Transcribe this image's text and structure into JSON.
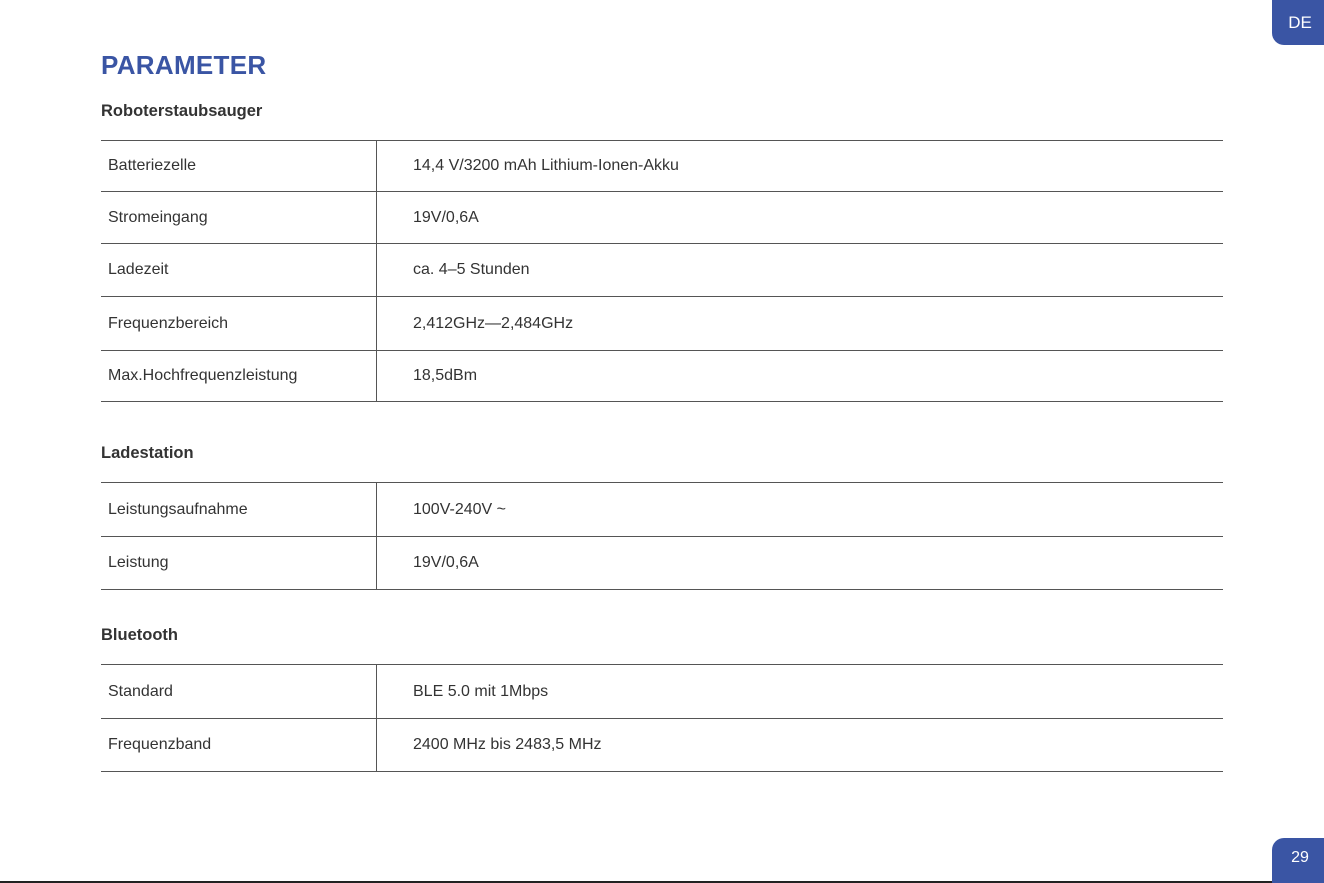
{
  "lang_tab": "DE",
  "page_number": "29",
  "title": "PARAMETER",
  "sections": [
    {
      "heading": "Roboterstaubsauger",
      "rows": [
        {
          "label": "Batteriezelle",
          "value": "14,4 V/3200 mAh Lithium-Ionen-Akku"
        },
        {
          "label": "Stromeingang",
          "value": "19V/0,6A"
        },
        {
          "label": "Ladezeit",
          "value": "ca. 4–5 Stunden"
        },
        {
          "label": "Frequenzbereich",
          "value": "2,412GHz—2,484GHz"
        },
        {
          "label": "Max.Hochfrequenzleistung",
          "value": "18,5dBm"
        }
      ]
    },
    {
      "heading": "Ladestation",
      "rows": [
        {
          "label": "Leistungsaufnahme",
          "value": "100V-240V ~"
        },
        {
          "label": "Leistung",
          "value": "19V/0,6A"
        }
      ]
    },
    {
      "heading": "Bluetooth",
      "rows": [
        {
          "label": "Standard",
          "value": "BLE 5.0 mit 1Mbps"
        },
        {
          "label": "Frequenzband",
          "value": "2400 MHz bis 2483,5 MHz"
        }
      ]
    }
  ]
}
